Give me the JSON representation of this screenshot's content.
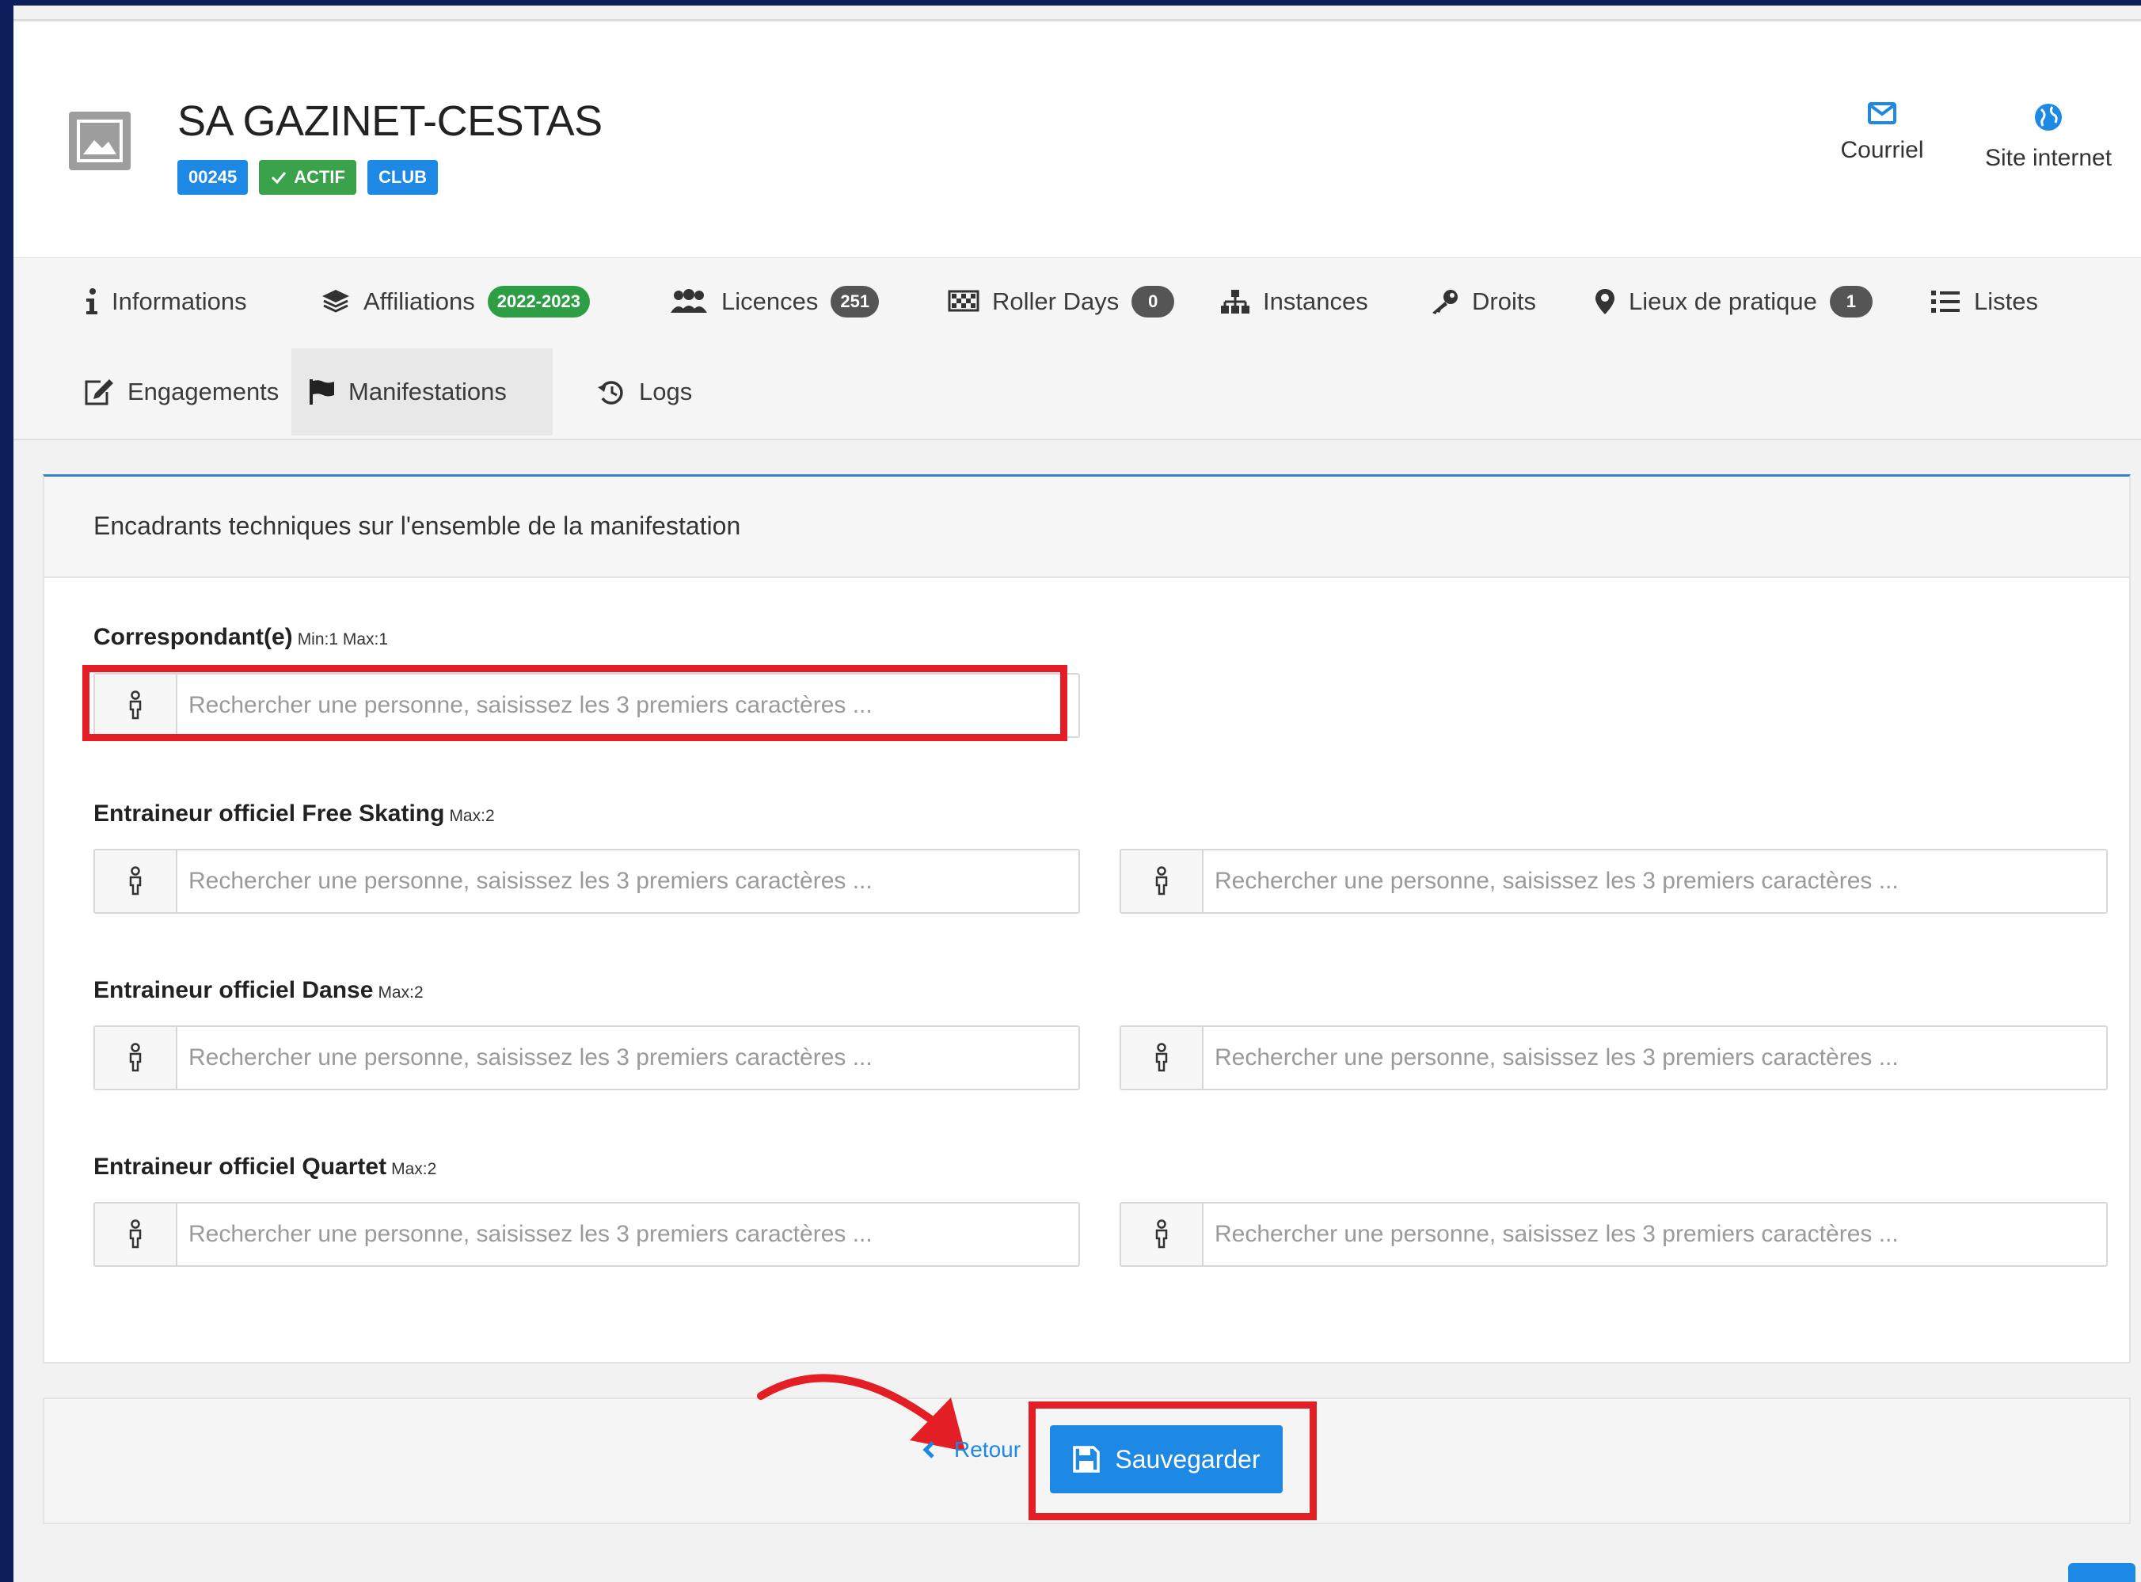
{
  "club": {
    "name": "SA GAZINET-CESTAS",
    "badges": {
      "code": "00245",
      "status": "ACTIF",
      "type": "CLUB"
    }
  },
  "header_links": {
    "email": "Courriel",
    "site": "Site internet"
  },
  "tabs": [
    {
      "label": "Informations",
      "icon": "info-icon"
    },
    {
      "label": "Affiliations",
      "icon": "layers-icon",
      "badge": "2022-2023"
    },
    {
      "label": "Licences",
      "icon": "users-icon",
      "badge": "251"
    },
    {
      "label": "Roller Days",
      "icon": "checkered-flag-icon",
      "badge": "0"
    },
    {
      "label": "Instances",
      "icon": "sitemap-icon"
    },
    {
      "label": "Droits",
      "icon": "key-icon"
    },
    {
      "label": "Lieux de pratique",
      "icon": "map-marker-icon",
      "badge": "1"
    },
    {
      "label": "Listes",
      "icon": "list-icon"
    },
    {
      "label": "Engagements",
      "icon": "edit-icon"
    },
    {
      "label": "Manifestations",
      "icon": "flag-icon",
      "active": true
    },
    {
      "label": "Logs",
      "icon": "history-icon"
    }
  ],
  "form": {
    "title": "Encadrants techniques sur l'ensemble de la manifestation",
    "placeholder": "Rechercher une personne, saisissez les 3 premiers caractères ...",
    "fields": [
      {
        "label": "Correspondant(e)",
        "limit": "Min:1 Max:1"
      },
      {
        "label": "Entraineur officiel Free Skating",
        "limit": "Max:2"
      },
      {
        "label": "Entraineur officiel Danse",
        "limit": "Max:2"
      },
      {
        "label": "Entraineur officiel Quartet",
        "limit": "Max:2"
      }
    ]
  },
  "actions": {
    "back": "Retour",
    "save": "Sauvegarder"
  },
  "colors": {
    "primary": "#1e88e5",
    "success": "#3aa24a",
    "highlight": "#e31e24",
    "frame": "#0c1f5c"
  }
}
